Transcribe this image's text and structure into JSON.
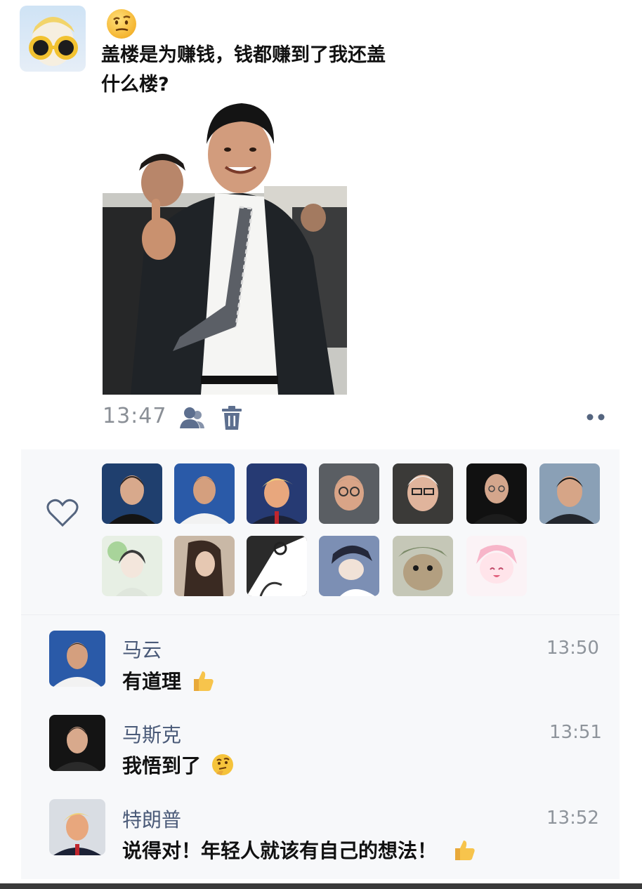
{
  "post": {
    "emoji": "face-with-raised-eyebrow",
    "text_line1": "盖楼是为赚钱，钱都赚到了我还盖",
    "text_line2": "什么楼?",
    "time": "13:47"
  },
  "reactions": {
    "likers_row1": [
      "liker-1",
      "liker-2",
      "liker-3",
      "liker-4",
      "liker-5",
      "liker-6",
      "liker-7"
    ],
    "likers_row2": [
      "liker-8",
      "liker-9",
      "liker-10",
      "liker-11",
      "liker-12",
      "liker-13"
    ]
  },
  "comments": [
    {
      "name": "马云",
      "text": "有道理",
      "emoji": "thumbs-up",
      "time": "13:50"
    },
    {
      "name": "马斯克",
      "text": "我悟到了",
      "emoji": "thinking-face",
      "time": "13:51"
    },
    {
      "name": "特朗普",
      "text": "说得对！年轻人就该有自己的想法！",
      "emoji": "thumbs-up",
      "time": "13:52"
    }
  ],
  "colors": {
    "name_blue": "#4a5a78",
    "time_gray": "#8a8f96",
    "panel_bg": "#f7f8fa"
  }
}
